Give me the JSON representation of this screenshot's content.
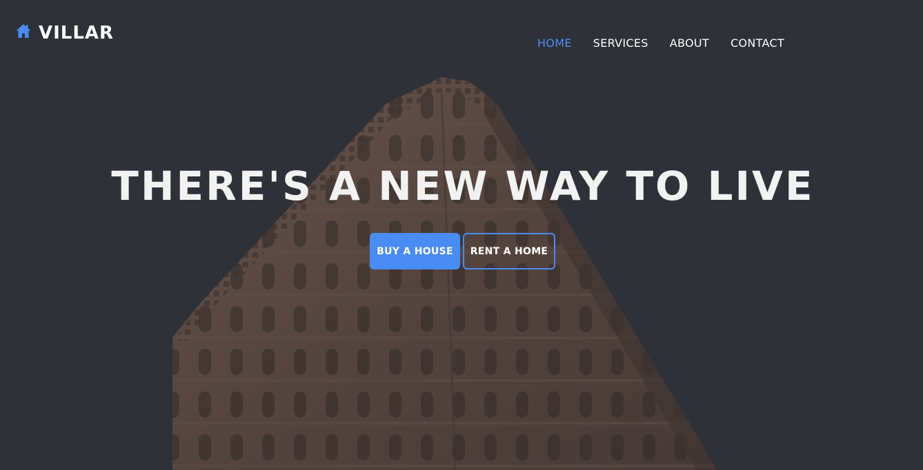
{
  "brand": {
    "name": "VILLAR",
    "icon": "home-icon",
    "accent": "#4a8cf5"
  },
  "nav": {
    "items": [
      {
        "label": "HOME",
        "active": true
      },
      {
        "label": "SERVICES",
        "active": false
      },
      {
        "label": "ABOUT",
        "active": false
      },
      {
        "label": "CONTACT",
        "active": false
      }
    ]
  },
  "hero": {
    "headline": "THERE'S A NEW WAY TO LIVE",
    "primary_button": "BUY A HOUSE",
    "secondary_button": "RENT A HOME"
  }
}
